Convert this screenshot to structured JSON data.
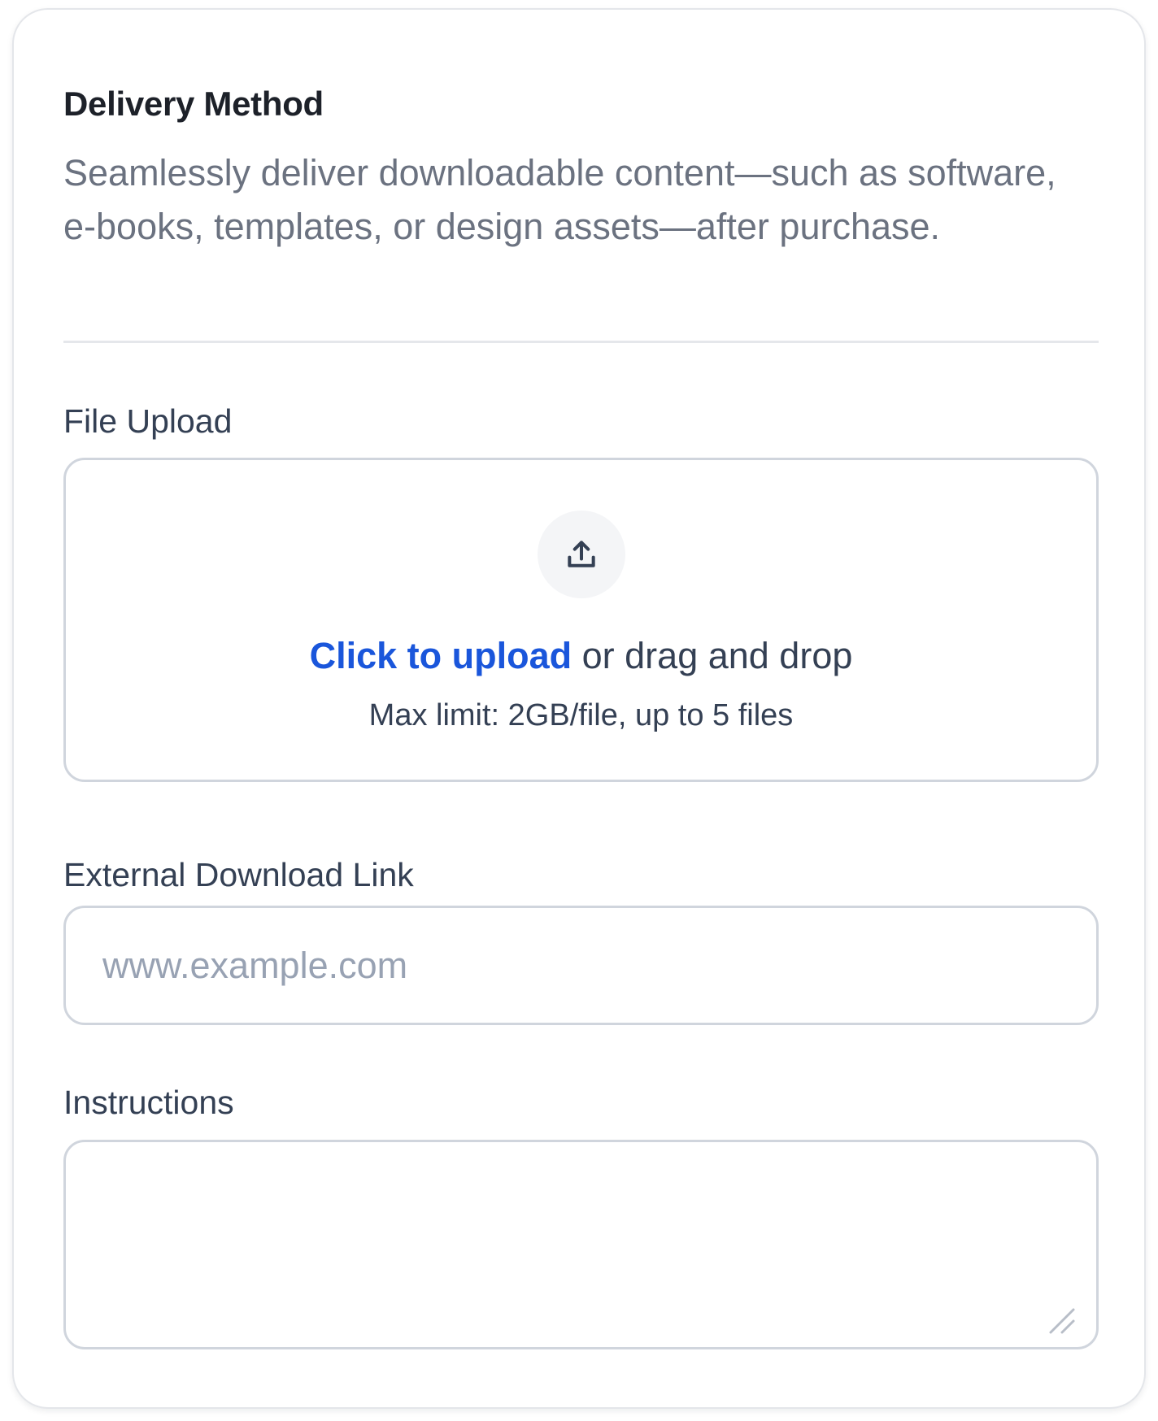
{
  "delivery": {
    "title": "Delivery Method",
    "description": "Seamlessly deliver downloadable content—such as software, e-books, templates, or design assets—after purchase."
  },
  "file_upload": {
    "label": "File Upload",
    "icon": "upload-icon",
    "click_text": "Click to upload",
    "drag_text": "or drag and drop",
    "limit_text": "Max limit: 2GB/file, up to 5 files",
    "link_color": "#1a56db"
  },
  "external_link": {
    "label": "External Download Link",
    "placeholder": "www.example.com",
    "value": ""
  },
  "instructions": {
    "label": "Instructions",
    "value": ""
  }
}
